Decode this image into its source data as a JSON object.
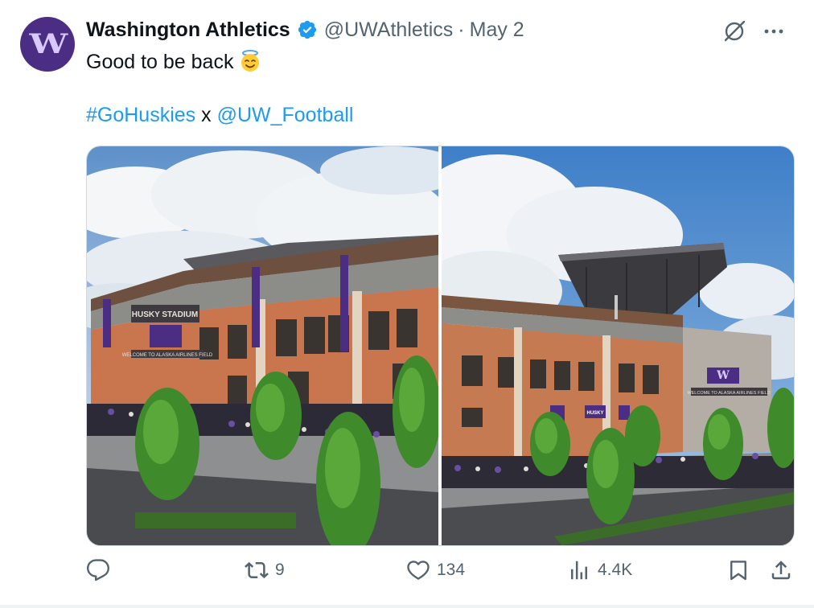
{
  "post": {
    "author_name": "Washington Athletics",
    "author_handle": "@UWAthletics",
    "separator": "·",
    "date": "May 2",
    "avatar_letter": "W",
    "text_line1": "Good to be back",
    "emoji": "halo-smile-emoji",
    "hashtag": "#GoHuskies",
    "connector": " x ",
    "mention": "@UW_Football"
  },
  "media": {
    "left_photo": {
      "stadium_sign": "HUSKY STADIUM",
      "banner_text": "WELCOME TO ALASKA AIRLINES FIELD"
    },
    "right_photo": {
      "banner_text": "WELCOME TO ALASKA AIRLINES FIELD",
      "husky_sign": "HUSKY"
    }
  },
  "actions": {
    "replies": "",
    "reposts": "9",
    "likes": "134",
    "views": "4.4K"
  },
  "colors": {
    "link": "#1d9bf0",
    "verified": "#1d9bf0",
    "muted": "#536471",
    "uw_purple": "#4b2e83"
  }
}
